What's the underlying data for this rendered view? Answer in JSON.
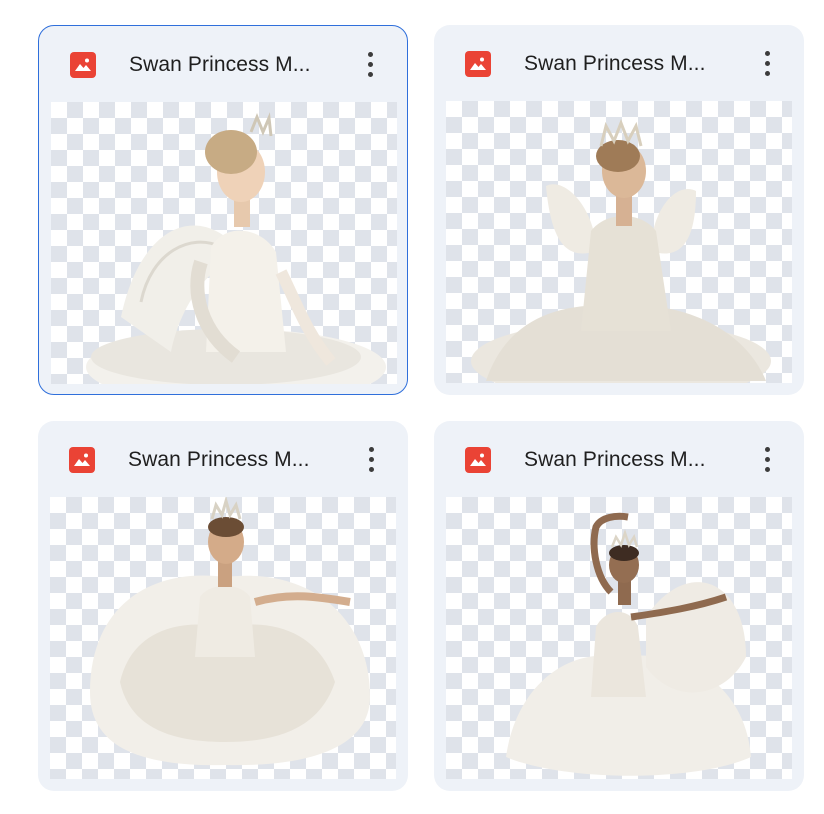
{
  "files": [
    {
      "title": "Swan Princess M...",
      "type_icon": "image-file-icon",
      "selected": true,
      "pose": "seated-side"
    },
    {
      "title": "Swan Princess M...",
      "type_icon": "image-file-icon",
      "selected": false,
      "pose": "seated-front"
    },
    {
      "title": "Swan Princess M...",
      "type_icon": "image-file-icon",
      "selected": false,
      "pose": "dancing-wide"
    },
    {
      "title": "Swan Princess M...",
      "type_icon": "image-file-icon",
      "selected": false,
      "pose": "dancing-arm-up"
    }
  ],
  "colors": {
    "card_bg": "#eef2f8",
    "selected_border": "#2f6fdb",
    "file_icon": "#ea4335"
  }
}
